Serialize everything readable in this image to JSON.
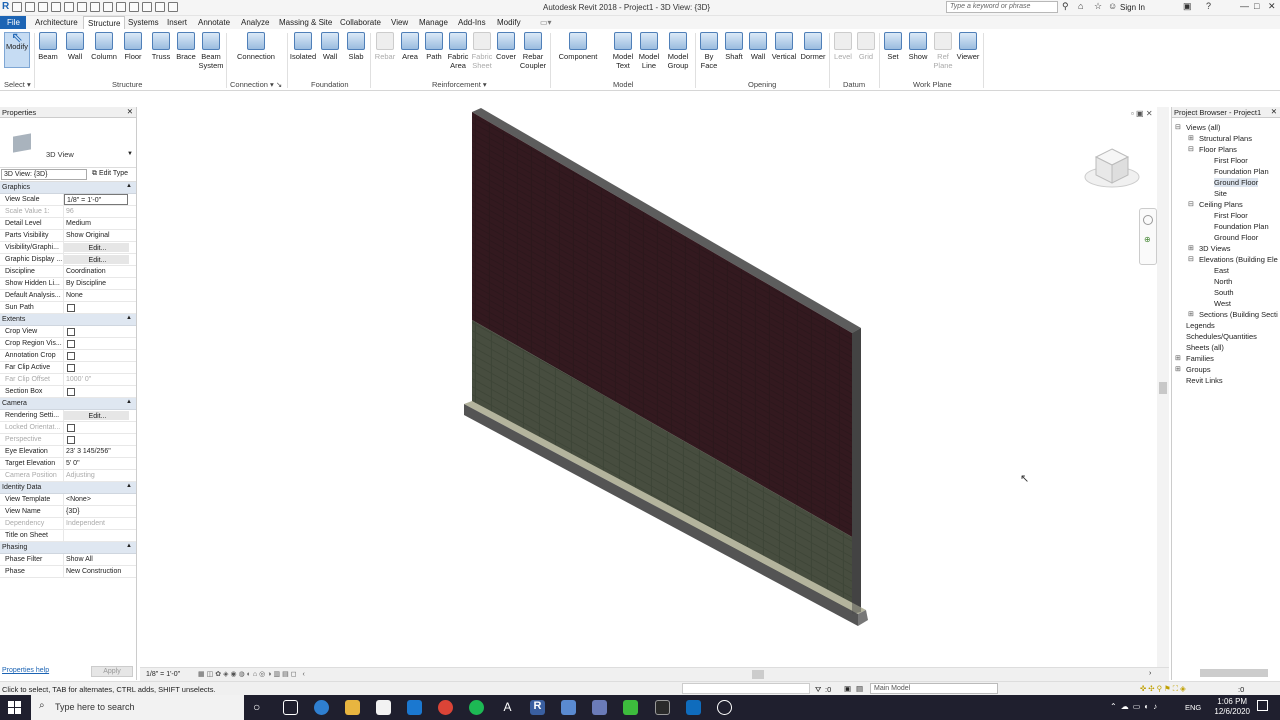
{
  "app": {
    "title": "Autodesk Revit 2018 -   Project1 - 3D View: {3D}",
    "search_placeholder": "Type a keyword or phrase",
    "sign_in": "Sign In"
  },
  "tabs": [
    "File",
    "Architecture",
    "Structure",
    "Systems",
    "Insert",
    "Annotate",
    "Analyze",
    "Massing & Site",
    "Collaborate",
    "View",
    "Manage",
    "Add-Ins",
    "Modify"
  ],
  "ribbon": {
    "modify": "Modify",
    "select": "Select",
    "structure_buttons": [
      "Beam",
      "Wall",
      "Column",
      "Floor",
      "Truss",
      "Brace",
      "Beam System"
    ],
    "connection_buttons": [
      "Connection"
    ],
    "foundation_buttons": [
      "Isolated",
      "Wall",
      "Slab"
    ],
    "reinforcement_buttons": [
      "Rebar",
      "Area",
      "Path",
      "Fabric Area",
      "Fabric Sheet",
      "Cover",
      "Rebar Coupler"
    ],
    "model_buttons": [
      "Component",
      "Model Text",
      "Model Line",
      "Model Group"
    ],
    "opening_buttons": [
      "By Face",
      "Shaft",
      "Wall",
      "Vertical",
      "Dormer"
    ],
    "datum_buttons": [
      "Level",
      "Grid"
    ],
    "workplane_buttons": [
      "Set",
      "Show",
      "Ref Plane",
      "Viewer"
    ],
    "panels": [
      "Structure",
      "Connection",
      "Foundation",
      "Reinforcement",
      "Model",
      "Opening",
      "Datum",
      "Work Plane"
    ]
  },
  "properties": {
    "title": "Properties",
    "type_name": "3D View",
    "filter": "3D View: {3D}",
    "edit_type": "Edit Type",
    "sections": {
      "graphics": "Graphics",
      "extents": "Extents",
      "camera": "Camera",
      "identity": "Identity Data",
      "phasing": "Phasing"
    },
    "graphics_rows": [
      {
        "k": "View Scale",
        "v": "1/8\" = 1'-0\""
      },
      {
        "k": "Scale Value    1:",
        "v": "96"
      },
      {
        "k": "Detail Level",
        "v": "Medium"
      },
      {
        "k": "Parts Visibility",
        "v": "Show Original"
      },
      {
        "k": "Visibility/Graphi...",
        "v": "Edit..."
      },
      {
        "k": "Graphic Display ...",
        "v": "Edit..."
      },
      {
        "k": "Discipline",
        "v": "Coordination"
      },
      {
        "k": "Show Hidden Li...",
        "v": "By Discipline"
      },
      {
        "k": "Default Analysis...",
        "v": "None"
      },
      {
        "k": "Sun Path",
        "v": ""
      }
    ],
    "extents_rows": [
      {
        "k": "Crop View",
        "v": ""
      },
      {
        "k": "Crop Region Vis...",
        "v": ""
      },
      {
        "k": "Annotation Crop",
        "v": ""
      },
      {
        "k": "Far Clip Active",
        "v": ""
      },
      {
        "k": "Far Clip Offset",
        "v": "1000'  0\""
      },
      {
        "k": "Section Box",
        "v": ""
      }
    ],
    "camera_rows": [
      {
        "k": "Rendering Setti...",
        "v": "Edit..."
      },
      {
        "k": "Locked Orientat...",
        "v": ""
      },
      {
        "k": "Perspective",
        "v": ""
      },
      {
        "k": "Eye Elevation",
        "v": "23'  3 145/256\""
      },
      {
        "k": "Target Elevation",
        "v": "5'  0\""
      },
      {
        "k": "Camera Position",
        "v": "Adjusting"
      }
    ],
    "identity_rows": [
      {
        "k": "View Template",
        "v": "<None>"
      },
      {
        "k": "View Name",
        "v": "{3D}"
      },
      {
        "k": "Dependency",
        "v": "Independent"
      },
      {
        "k": "Title on Sheet",
        "v": ""
      }
    ],
    "phasing_rows": [
      {
        "k": "Phase Filter",
        "v": "Show All"
      },
      {
        "k": "Phase",
        "v": "New Construction"
      }
    ],
    "help": "Properties help",
    "apply": "Apply"
  },
  "view_controls": {
    "scale": "1/8\" = 1'-0\""
  },
  "browser": {
    "title": "Project Browser - Project1",
    "nodes": [
      "Views (all)",
      "Structural Plans",
      "Floor Plans",
      "First Floor",
      "Foundation Plan",
      "Ground Floor",
      "Site",
      "Ceiling Plans",
      "First Floor",
      "Foundation Plan",
      "Ground Floor",
      "3D Views",
      "Elevations (Building Ele",
      "East",
      "North",
      "South",
      "West",
      "Sections (Building Secti",
      "Legends",
      "Schedules/Quantities",
      "Sheets (all)",
      "Families",
      "Groups",
      "Revit Links"
    ],
    "selected": "Ground Floor"
  },
  "status": {
    "text": "Click to select, TAB for alternates, CTRL adds, SHIFT unselects.",
    "zero": ":0",
    "model": "Main Model"
  },
  "taskbar": {
    "search": "Type here to search",
    "lang": "ENG",
    "time": "1:06 PM",
    "date": "12/6/2020"
  }
}
